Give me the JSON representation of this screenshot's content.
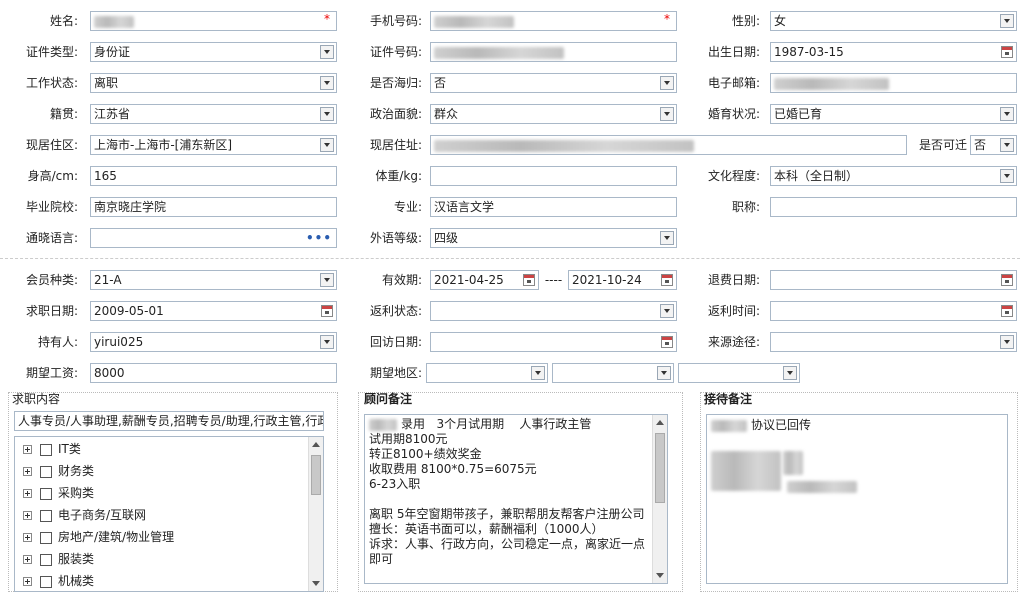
{
  "basic": {
    "name_label": "姓名:",
    "phone_label": "手机号码:",
    "gender_label": "性别:",
    "gender_value": "女",
    "idtype_label": "证件类型:",
    "idtype_value": "身份证",
    "idno_label": "证件号码:",
    "birth_label": "出生日期:",
    "birth_value": "1987-03-15",
    "workstatus_label": "工作状态:",
    "workstatus_value": "离职",
    "overseas_label": "是否海归:",
    "overseas_value": "否",
    "email_label": "电子邮箱:",
    "native_label": "籍贯:",
    "native_value": "江苏省",
    "political_label": "政治面貌:",
    "political_value": "群众",
    "marital_label": "婚育状况:",
    "marital_value": "已婚已育",
    "area_label": "现居住区:",
    "area_value": "上海市-上海市-[浦东新区]",
    "address_label": "现居住址:",
    "relocate_label": "是否可迁",
    "relocate_value": "否",
    "height_label": "身高/cm:",
    "height_value": "165",
    "weight_label": "体重/kg:",
    "education_label": "文化程度:",
    "education_value": "本科（全日制）",
    "school_label": "毕业院校:",
    "school_value": "南京晓庄学院",
    "major_label": "专业:",
    "major_value": "汉语言文学",
    "title_label": "职称:",
    "language_label": "通晓语言:",
    "language_more": "•••",
    "foreign_label": "外语等级:",
    "foreign_value": "四级"
  },
  "member": {
    "type_label": "会员种类:",
    "type_value": "21-A",
    "valid_label": "有效期:",
    "valid_from": "2021-04-25",
    "valid_sep": "----",
    "valid_to": "2021-10-24",
    "refund_label": "退费日期:",
    "jobdate_label": "求职日期:",
    "jobdate_value": "2009-05-01",
    "rebate_status_label": "返利状态:",
    "rebate_time_label": "返利时间:",
    "holder_label": "持有人:",
    "holder_value": "yirui025",
    "visit_label": "回访日期:",
    "source_label": "来源途径:",
    "salary_label": "期望工资:",
    "salary_value": "8000",
    "region_label": "期望地区:"
  },
  "job": {
    "title": "求职内容",
    "summary": "人事专员/人事助理,薪酬专员,招聘专员/助理,行政主管,行政",
    "categories": [
      "IT类",
      "财务类",
      "采购类",
      "电子商务/互联网",
      "房地产/建筑/物业管理",
      "服装类",
      "机械类"
    ]
  },
  "advisor": {
    "title": "顾问备注",
    "note": "录用   3个月试用期    人事行政主管\n试用期8100元\n转正8100+绩效奖金\n收取费用 8100*0.75=6075元\n6-23入职\n\n离职 5年空窗期带孩子，兼职帮朋友帮客户注册公司\n擅长：英语书面可以，薪酬福利（1000人）\n诉求：人事、行政方向，公司稳定一点，离家近一点\n即可"
  },
  "reception": {
    "title": "接待备注",
    "note": "协议已回传"
  }
}
